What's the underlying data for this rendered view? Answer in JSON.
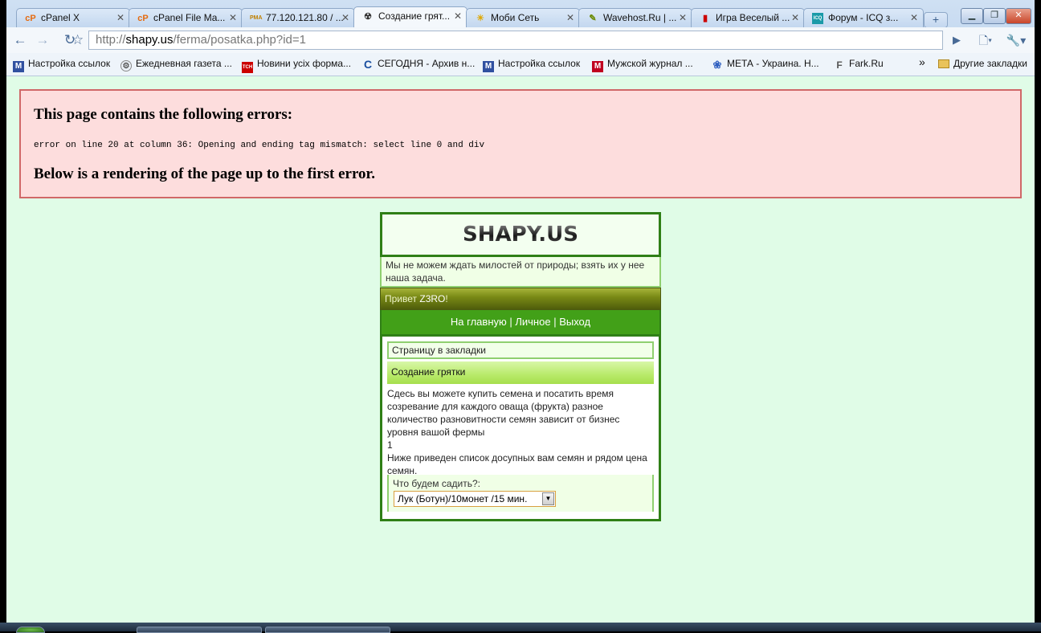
{
  "browser": {
    "tabs": [
      {
        "label": "cPanel X",
        "icon": "cpanel-icon",
        "favicon_text": "cP",
        "active": false
      },
      {
        "label": "cPanel File Ma...",
        "icon": "cpanel-icon",
        "favicon_text": "cP",
        "active": false
      },
      {
        "label": "77.120.121.80 / ...",
        "icon": "phpmyadmin-icon",
        "favicon_text": "PMA",
        "active": false
      },
      {
        "label": "Создание грят...",
        "icon": "hazard-icon",
        "favicon_text": "☢",
        "active": true
      },
      {
        "label": "Моби Сеть",
        "icon": "sun-icon",
        "favicon_text": "☀",
        "active": false
      },
      {
        "label": "Wavehost.Ru | ...",
        "icon": "wavehost-icon",
        "favicon_text": "✎",
        "active": false
      },
      {
        "label": "Игра Веселый ...",
        "icon": "game-icon",
        "favicon_text": "▮",
        "active": false
      },
      {
        "label": "Форум - ICQ з...",
        "icon": "icq-icon",
        "favicon_text": "ICQ",
        "active": false
      }
    ],
    "new_tab_symbol": "+",
    "window_controls": {
      "minimize": "▁",
      "maximize": "❐",
      "close": "✕"
    },
    "nav": {
      "back": "←",
      "forward": "→",
      "reload": "↻",
      "star": "☆",
      "go": "▶",
      "page_menu": "🗋▾",
      "wrench_menu": "🔧▾"
    },
    "url": {
      "prefix": "http://",
      "host": "shapy.us",
      "path": "/ferma/posatka.php?id=1"
    },
    "bookmarks": [
      {
        "label": "Настройка ссылок",
        "icon": "m-icon",
        "favicon_text": "M"
      },
      {
        "label": "Ежедневная газета ...",
        "icon": "newspaper-icon",
        "favicon_text": "⚙"
      },
      {
        "label": "Новини усіх форма...",
        "icon": "tsn-icon",
        "favicon_text": "ТСН"
      },
      {
        "label": "СЕГОДНЯ - Архив н...",
        "icon": "segodnya-icon",
        "favicon_text": "C"
      },
      {
        "label": "Настройка ссылок",
        "icon": "m-icon",
        "favicon_text": "M"
      },
      {
        "label": "Мужской журнал ...",
        "icon": "magazine-icon",
        "favicon_text": "M"
      },
      {
        "label": "МЕТА - Украина. Н...",
        "icon": "meta-icon",
        "favicon_text": "❀"
      },
      {
        "label": "Fark.Ru",
        "icon": "fark-icon",
        "favicon_text": "F"
      }
    ],
    "bookmarks_overflow": "»",
    "other_bookmarks": "Другие закладки"
  },
  "error": {
    "title": "This page contains the following errors:",
    "message": "error on line 20 at column 36: Opening and ending tag mismatch: select line 0 and div",
    "below": "Below is a rendering of the page up to the first error."
  },
  "site": {
    "logo": "SHAPY.US",
    "slogan": "Мы не можем ждать милостей от природы; взять их у нее наша задача.",
    "greeting_prefix": "Привет ",
    "username": "Z3RO",
    "greeting_suffix": "!",
    "nav": {
      "home": "На главную",
      "sep1": " | ",
      "personal": "Личное",
      "sep2": " | ",
      "logout": "Выход"
    },
    "bookmark_link": "Страницу в закладки",
    "section_title": "Создание грятки",
    "description_1": "Сдесь вы можете купить семена и посатить время созревание для каждого оваща (фрукта) разное количество разновитности семян зависит от бизнес уровня вашой фермы",
    "level": "1",
    "description_2": "Ниже приведен список досупных вам семян и рядом цена семян.",
    "form_label": "Что будем садить?:",
    "selected_seed": "Лук (Ботун)/10монет /15 мин."
  },
  "colors": {
    "page_bg": "#e0fce7",
    "error_bg": "#fddddd",
    "error_border": "#d06868",
    "site_green": "#2f7f16",
    "nav_green": "#42a018"
  }
}
